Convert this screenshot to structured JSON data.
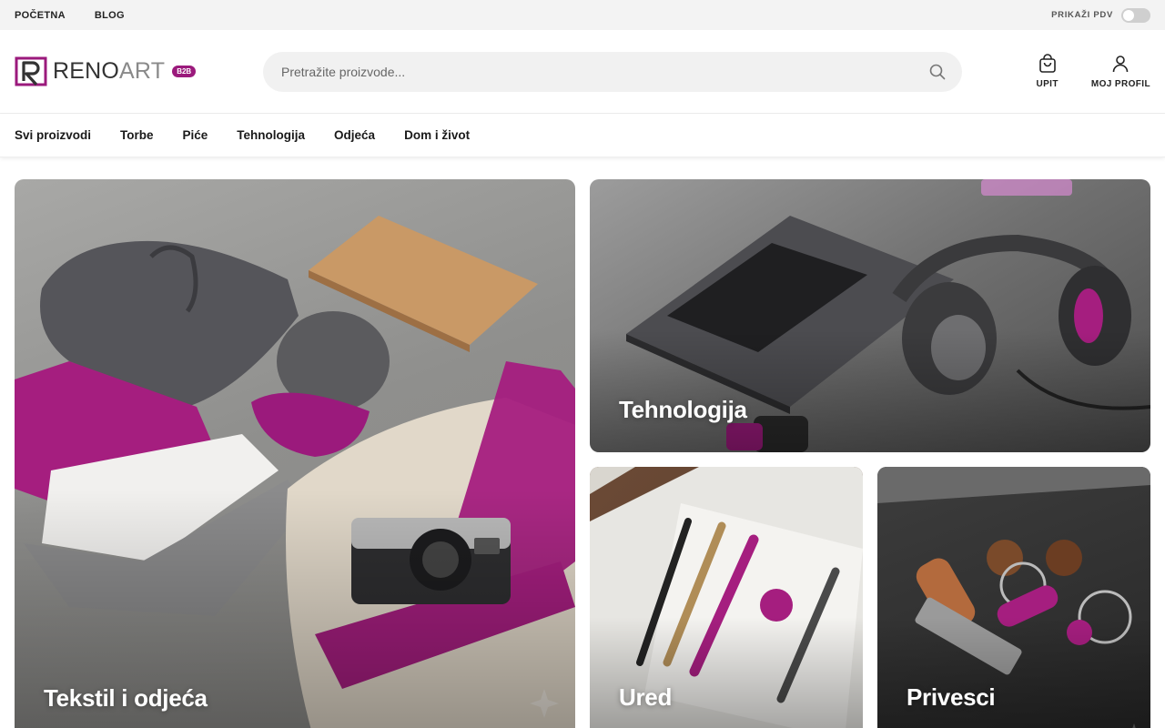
{
  "topbar": {
    "links": [
      "POČETNA",
      "BLOG"
    ],
    "vat_label": "PRIKAŽI PDV"
  },
  "header": {
    "logo": {
      "name_dark": "RENO",
      "name_light": "ART",
      "badge": "B2B"
    },
    "search_placeholder": "Pretražite proizvode...",
    "actions": {
      "inquiry": "UPIT",
      "profile": "MOJ PROFIL"
    }
  },
  "nav": {
    "items": [
      "Svi proizvodi",
      "Torbe",
      "Piće",
      "Tehnologija",
      "Odjeća",
      "Dom i život"
    ]
  },
  "categories": {
    "textile": "Tekstil i odjeća",
    "tech": "Tehnologija",
    "office": "Ured",
    "keychains": "Privesci"
  },
  "colors": {
    "brand": "#9b1a7c",
    "accent": "#b0177e"
  }
}
